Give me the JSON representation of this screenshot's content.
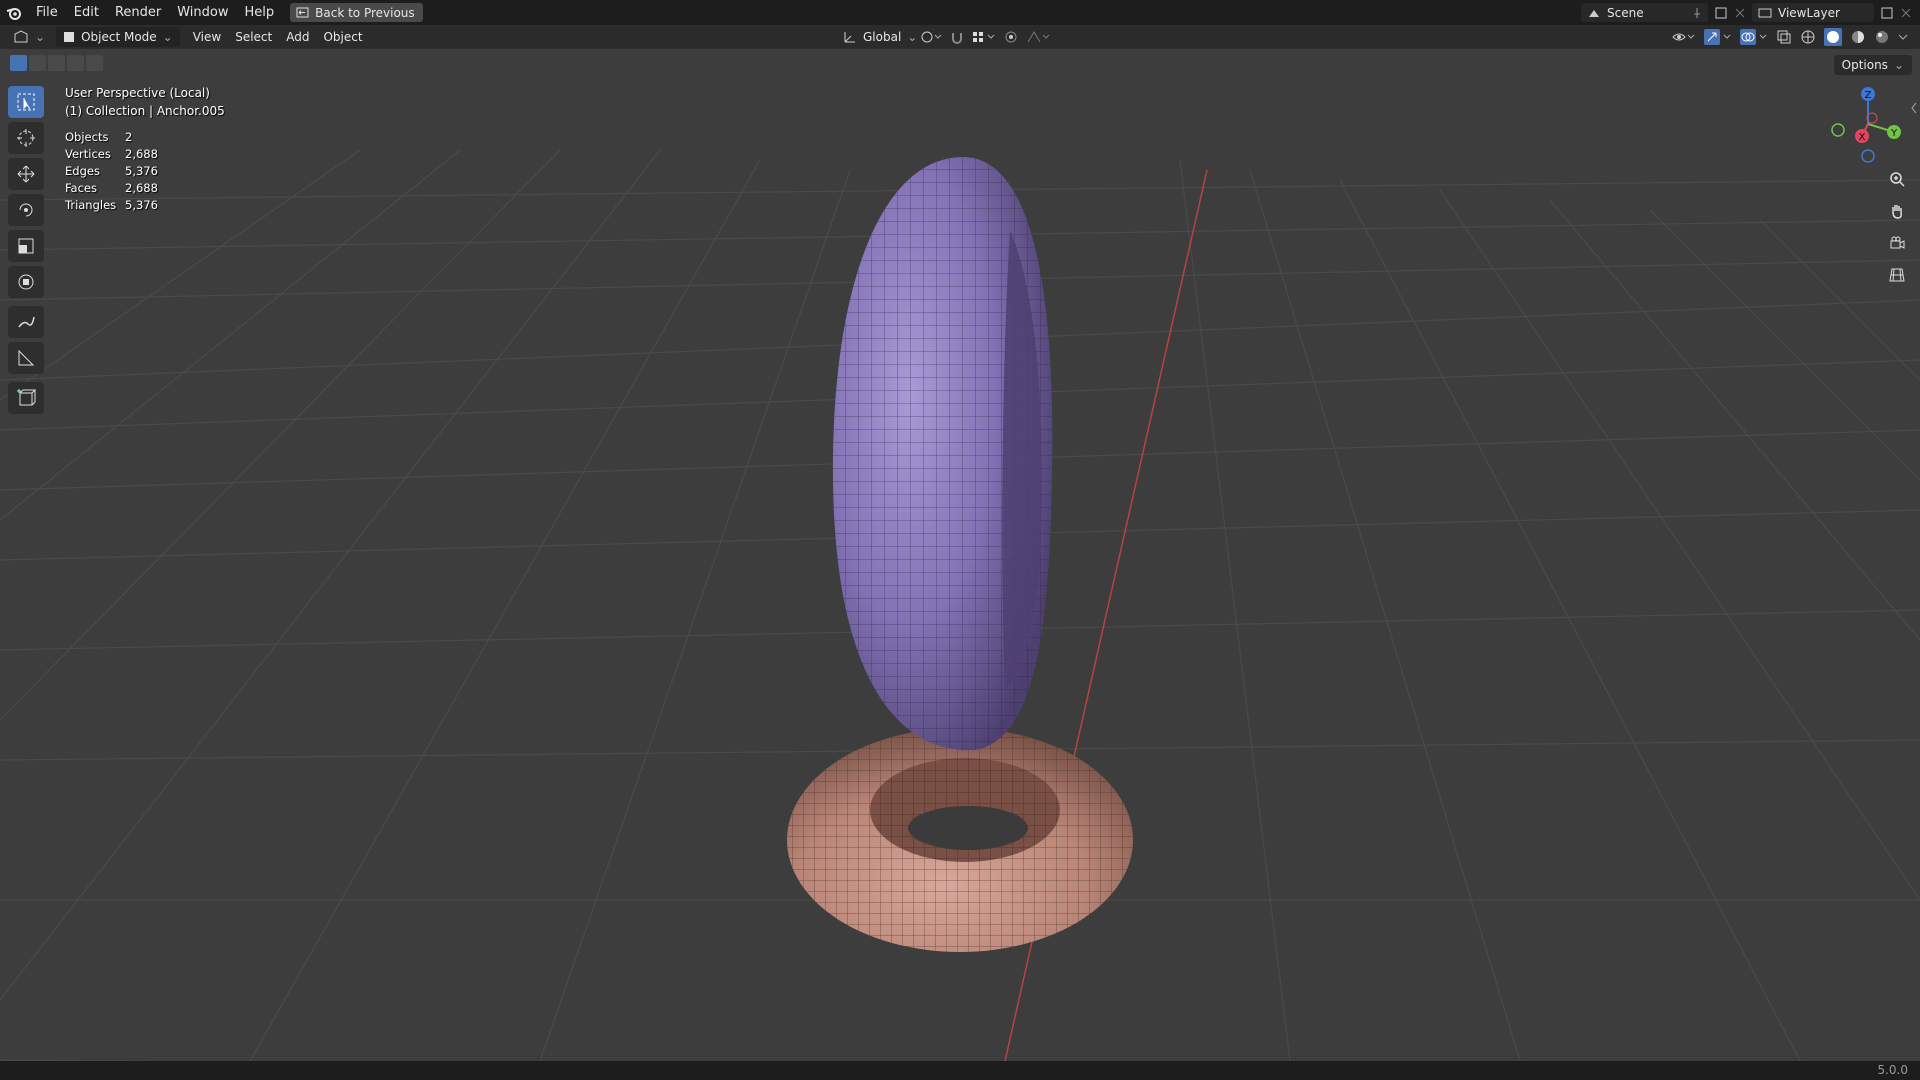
{
  "topbar": {
    "menus": [
      "File",
      "Edit",
      "Render",
      "Window",
      "Help"
    ],
    "back_button": "Back to Previous",
    "scene_label": "Scene",
    "view_layer_label": "ViewLayer"
  },
  "header": {
    "mode": "Object Mode",
    "menus": [
      "View",
      "Select",
      "Add",
      "Object"
    ],
    "transform_orientation": "Global"
  },
  "viewport": {
    "perspective": "User Perspective (Local)",
    "collection": "(1) Collection | Anchor.005",
    "stats": [
      {
        "label": "Objects",
        "value": "2"
      },
      {
        "label": "Vertices",
        "value": "2,688"
      },
      {
        "label": "Edges",
        "value": "5,376"
      },
      {
        "label": "Faces",
        "value": "2,688"
      },
      {
        "label": "Triangles",
        "value": "5,376"
      }
    ],
    "options_label": "Options",
    "gizmo_labels": {
      "x": "X",
      "y": "Y",
      "z": "Z"
    }
  },
  "statusbar": {
    "version": "5.0.0"
  },
  "colors": {
    "accent": "#4772b3",
    "upper_torus": "#8877b8",
    "lower_torus": "#c9958a",
    "axis_red": "#c24a4a"
  }
}
